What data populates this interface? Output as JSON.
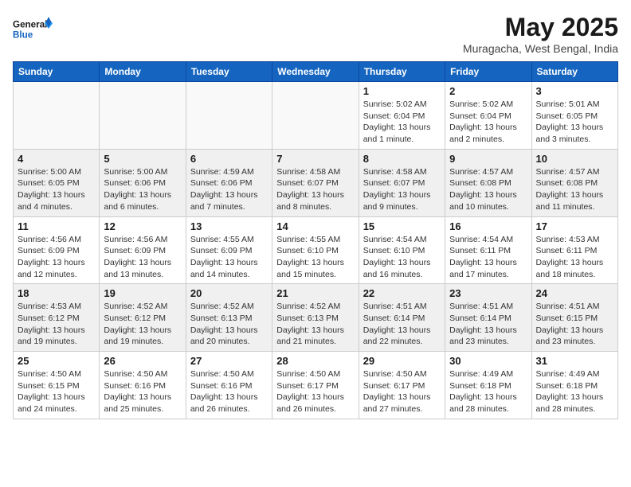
{
  "header": {
    "logo_line1": "General",
    "logo_line2": "Blue",
    "month_year": "May 2025",
    "location": "Muragacha, West Bengal, India"
  },
  "days_of_week": [
    "Sunday",
    "Monday",
    "Tuesday",
    "Wednesday",
    "Thursday",
    "Friday",
    "Saturday"
  ],
  "weeks": [
    [
      {
        "num": "",
        "info": ""
      },
      {
        "num": "",
        "info": ""
      },
      {
        "num": "",
        "info": ""
      },
      {
        "num": "",
        "info": ""
      },
      {
        "num": "1",
        "info": "Sunrise: 5:02 AM\nSunset: 6:04 PM\nDaylight: 13 hours\nand 1 minute."
      },
      {
        "num": "2",
        "info": "Sunrise: 5:02 AM\nSunset: 6:04 PM\nDaylight: 13 hours\nand 2 minutes."
      },
      {
        "num": "3",
        "info": "Sunrise: 5:01 AM\nSunset: 6:05 PM\nDaylight: 13 hours\nand 3 minutes."
      }
    ],
    [
      {
        "num": "4",
        "info": "Sunrise: 5:00 AM\nSunset: 6:05 PM\nDaylight: 13 hours\nand 4 minutes."
      },
      {
        "num": "5",
        "info": "Sunrise: 5:00 AM\nSunset: 6:06 PM\nDaylight: 13 hours\nand 6 minutes."
      },
      {
        "num": "6",
        "info": "Sunrise: 4:59 AM\nSunset: 6:06 PM\nDaylight: 13 hours\nand 7 minutes."
      },
      {
        "num": "7",
        "info": "Sunrise: 4:58 AM\nSunset: 6:07 PM\nDaylight: 13 hours\nand 8 minutes."
      },
      {
        "num": "8",
        "info": "Sunrise: 4:58 AM\nSunset: 6:07 PM\nDaylight: 13 hours\nand 9 minutes."
      },
      {
        "num": "9",
        "info": "Sunrise: 4:57 AM\nSunset: 6:08 PM\nDaylight: 13 hours\nand 10 minutes."
      },
      {
        "num": "10",
        "info": "Sunrise: 4:57 AM\nSunset: 6:08 PM\nDaylight: 13 hours\nand 11 minutes."
      }
    ],
    [
      {
        "num": "11",
        "info": "Sunrise: 4:56 AM\nSunset: 6:09 PM\nDaylight: 13 hours\nand 12 minutes."
      },
      {
        "num": "12",
        "info": "Sunrise: 4:56 AM\nSunset: 6:09 PM\nDaylight: 13 hours\nand 13 minutes."
      },
      {
        "num": "13",
        "info": "Sunrise: 4:55 AM\nSunset: 6:09 PM\nDaylight: 13 hours\nand 14 minutes."
      },
      {
        "num": "14",
        "info": "Sunrise: 4:55 AM\nSunset: 6:10 PM\nDaylight: 13 hours\nand 15 minutes."
      },
      {
        "num": "15",
        "info": "Sunrise: 4:54 AM\nSunset: 6:10 PM\nDaylight: 13 hours\nand 16 minutes."
      },
      {
        "num": "16",
        "info": "Sunrise: 4:54 AM\nSunset: 6:11 PM\nDaylight: 13 hours\nand 17 minutes."
      },
      {
        "num": "17",
        "info": "Sunrise: 4:53 AM\nSunset: 6:11 PM\nDaylight: 13 hours\nand 18 minutes."
      }
    ],
    [
      {
        "num": "18",
        "info": "Sunrise: 4:53 AM\nSunset: 6:12 PM\nDaylight: 13 hours\nand 19 minutes."
      },
      {
        "num": "19",
        "info": "Sunrise: 4:52 AM\nSunset: 6:12 PM\nDaylight: 13 hours\nand 19 minutes."
      },
      {
        "num": "20",
        "info": "Sunrise: 4:52 AM\nSunset: 6:13 PM\nDaylight: 13 hours\nand 20 minutes."
      },
      {
        "num": "21",
        "info": "Sunrise: 4:52 AM\nSunset: 6:13 PM\nDaylight: 13 hours\nand 21 minutes."
      },
      {
        "num": "22",
        "info": "Sunrise: 4:51 AM\nSunset: 6:14 PM\nDaylight: 13 hours\nand 22 minutes."
      },
      {
        "num": "23",
        "info": "Sunrise: 4:51 AM\nSunset: 6:14 PM\nDaylight: 13 hours\nand 23 minutes."
      },
      {
        "num": "24",
        "info": "Sunrise: 4:51 AM\nSunset: 6:15 PM\nDaylight: 13 hours\nand 23 minutes."
      }
    ],
    [
      {
        "num": "25",
        "info": "Sunrise: 4:50 AM\nSunset: 6:15 PM\nDaylight: 13 hours\nand 24 minutes."
      },
      {
        "num": "26",
        "info": "Sunrise: 4:50 AM\nSunset: 6:16 PM\nDaylight: 13 hours\nand 25 minutes."
      },
      {
        "num": "27",
        "info": "Sunrise: 4:50 AM\nSunset: 6:16 PM\nDaylight: 13 hours\nand 26 minutes."
      },
      {
        "num": "28",
        "info": "Sunrise: 4:50 AM\nSunset: 6:17 PM\nDaylight: 13 hours\nand 26 minutes."
      },
      {
        "num": "29",
        "info": "Sunrise: 4:50 AM\nSunset: 6:17 PM\nDaylight: 13 hours\nand 27 minutes."
      },
      {
        "num": "30",
        "info": "Sunrise: 4:49 AM\nSunset: 6:18 PM\nDaylight: 13 hours\nand 28 minutes."
      },
      {
        "num": "31",
        "info": "Sunrise: 4:49 AM\nSunset: 6:18 PM\nDaylight: 13 hours\nand 28 minutes."
      }
    ]
  ]
}
